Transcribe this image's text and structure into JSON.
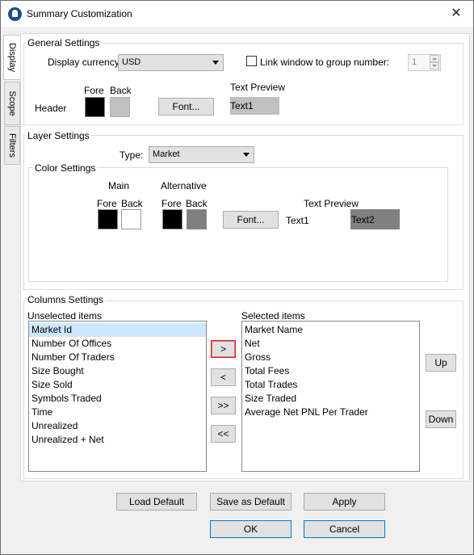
{
  "window": {
    "title": "Summary Customization"
  },
  "tabs": [
    {
      "label": "Display",
      "active": true
    },
    {
      "label": "Scope",
      "active": false
    },
    {
      "label": "Filters",
      "active": false
    }
  ],
  "general_settings": {
    "group_label": "General Settings",
    "currency_label": "Display currency:",
    "currency_value": "USD",
    "link_label": "Link window to group number:",
    "link_checked": false,
    "group_number": "1",
    "fore_label": "Fore",
    "back_label": "Back",
    "header_label": "Header",
    "font_button": "Font...",
    "text_preview_label": "Text Preview",
    "preview_text": "Text1",
    "colors": {
      "fore": "#000000",
      "back": "#c0c0c0",
      "preview_bg": "#c0c0c0"
    }
  },
  "layer_settings": {
    "group_label": "Layer Settings",
    "type_label": "Type:",
    "type_value": "Market",
    "color_settings": {
      "group_label": "Color Settings",
      "main_label": "Main",
      "alternative_label": "Alternative",
      "fore_label": "Fore",
      "back_label": "Back",
      "alt_fore_label": "Fore",
      "alt_back_label": "Back",
      "text_preview_label": "Text Preview",
      "font_button": "Font...",
      "preview_text1": "Text1",
      "preview_text2": "Text2",
      "colors": {
        "main_fore": "#000000",
        "main_back": "#ffffff",
        "alt_fore": "#000000",
        "alt_back": "#808080",
        "text2_bg": "#808080"
      }
    }
  },
  "columns_settings": {
    "group_label": "Columns Settings",
    "unselected_label": "Unselected items",
    "selected_label": "Selected items",
    "unselected_items": [
      "Market Id",
      "Number Of Offices",
      "Number Of Traders",
      "Size Bought",
      "Size Sold",
      "Symbols Traded",
      "Time",
      "Unrealized",
      "Unrealized + Net"
    ],
    "selected_items": [
      "Market Name",
      "Net",
      "Gross",
      "Total Fees",
      "Total Trades",
      "Size Traded",
      "Average Net PNL Per Trader"
    ],
    "move_right": ">",
    "move_left": "<",
    "move_all_right": ">>",
    "move_all_left": "<<",
    "up_button": "Up",
    "down_button": "Down"
  },
  "footer": {
    "load_default": "Load Default",
    "save_as_default": "Save as Default",
    "apply": "Apply",
    "ok": "OK",
    "cancel": "Cancel"
  }
}
